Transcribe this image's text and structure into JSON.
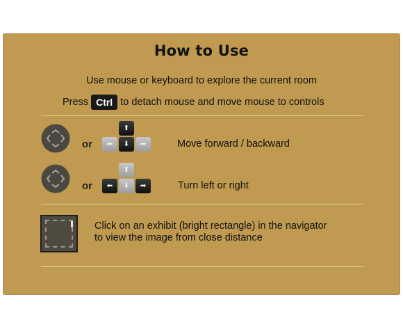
{
  "title": "How to Use",
  "intro": {
    "explore": "Use mouse or keyboard to explore the current room",
    "press_prefix": "Press",
    "key": "Ctrl",
    "press_suffix": "to detach mouse and move mouse to controls"
  },
  "controls": [
    {
      "or": "or",
      "icon": "arrows-circle-icon",
      "keys": {
        "up": "⬆",
        "left": "⬅",
        "down": "⬇",
        "right": "➡",
        "highlight": [
          "up",
          "down"
        ]
      },
      "description": "Move forward / backward"
    },
    {
      "or": "or",
      "icon": "arrows-circle-icon",
      "keys": {
        "up": "⬆",
        "left": "⬅",
        "down": "⬇",
        "right": "➡",
        "highlight": [
          "left",
          "right"
        ]
      },
      "description": "Turn left or right"
    }
  ],
  "exhibit": {
    "icon": "exhibit-thumbnail-icon",
    "line1": "Click on an exhibit (bright rectangle) in the navigator",
    "line2": "to view the image from close distance"
  },
  "colors": {
    "panel_bg": "#c09a50",
    "divider": "#e6cf98",
    "key_dark": "#1a1a1a",
    "key_light": "#b0b0b0",
    "circle": "#4a4840"
  }
}
